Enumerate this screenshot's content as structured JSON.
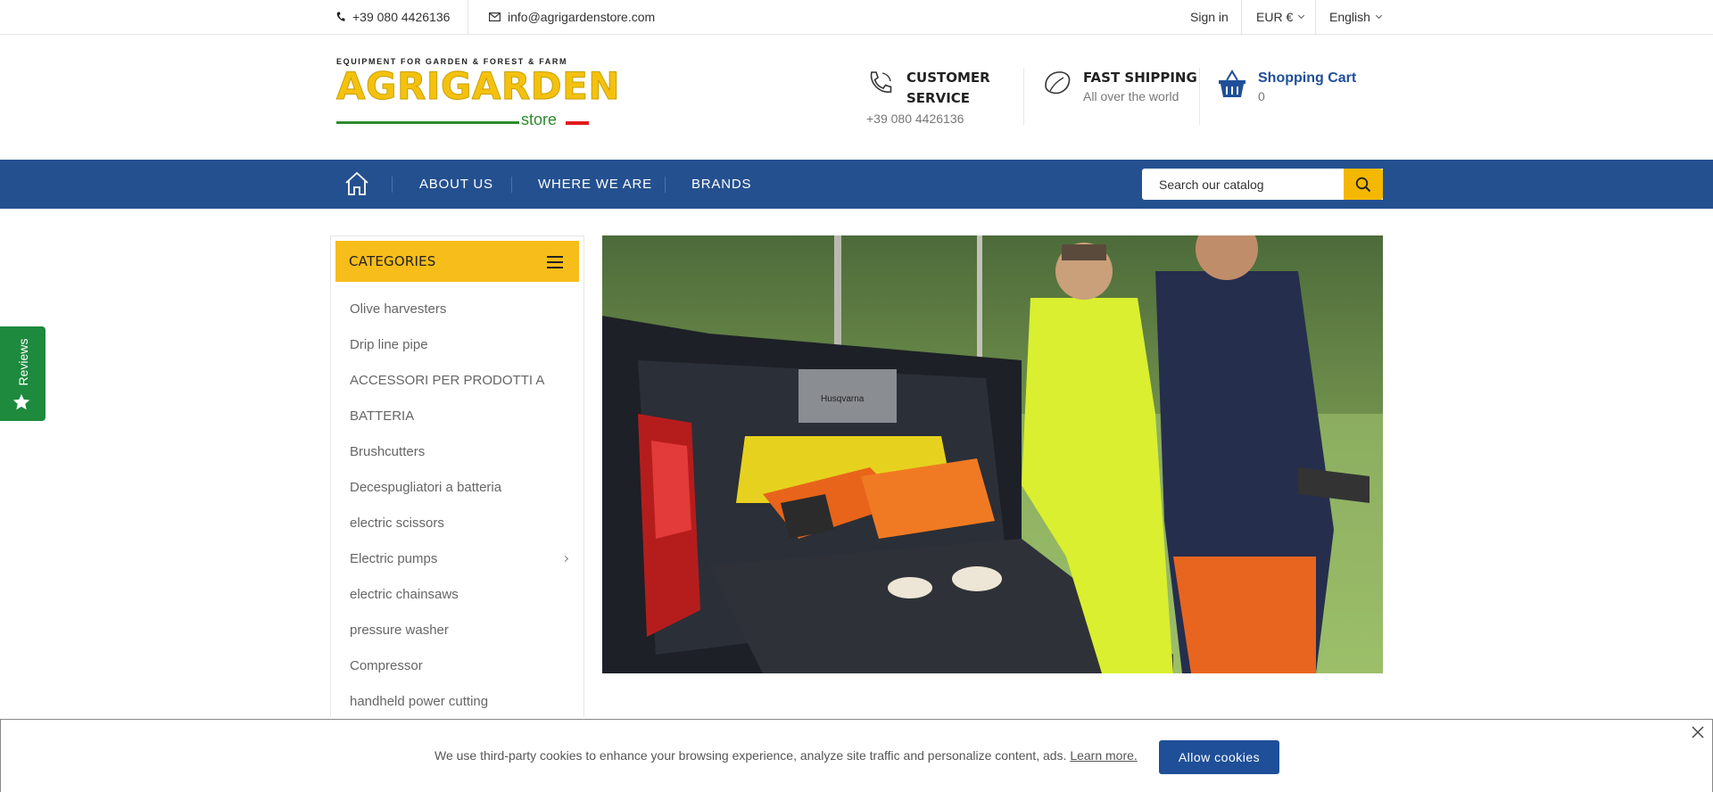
{
  "topbar": {
    "phone": "+39 080 4426136",
    "email": "info@agrigardenstore.com",
    "signin": "Sign in",
    "currency": "EUR €",
    "language": "English"
  },
  "logo": {
    "tagline": "EQUIPMENT FOR GARDEN & FOREST & FARM",
    "brand": "AGRIGARDEN",
    "sub": "store"
  },
  "header": {
    "customer_service": {
      "title1": "CUSTOMER",
      "title2": "SERVICE",
      "phone": "+39 080 4426136"
    },
    "shipping": {
      "title": "FAST SHIPPING",
      "subtitle": "All over the world"
    },
    "cart": {
      "title": "Shopping Cart",
      "count": "0"
    }
  },
  "nav": {
    "items": [
      "ABOUT US",
      "WHERE WE ARE",
      "BRANDS"
    ],
    "search_placeholder": "Search our catalog"
  },
  "reviews": {
    "label": "Reviews"
  },
  "categories": {
    "title": "CATEGORIES",
    "items": [
      "Olive harvesters",
      "Drip line pipe",
      "ACCESSORI PER PRODOTTI A",
      "BATTERIA",
      "Brushcutters",
      "Decespugliatori a batteria",
      "electric scissors",
      "Electric pumps",
      "electric chainsaws",
      "pressure washer",
      "Compressor",
      "handheld power cutting"
    ]
  },
  "hero": {
    "device_label": "Husqvarna"
  },
  "cookie": {
    "message": "We use third-party cookies to enhance your browsing experience, analyze site traffic and personalize content, ads.",
    "link": "Learn more.",
    "button": "Allow cookies"
  },
  "colors": {
    "nav_blue": "#24508f",
    "accent_yellow": "#f7bd1a",
    "reviews_green": "#1d8a3e"
  }
}
